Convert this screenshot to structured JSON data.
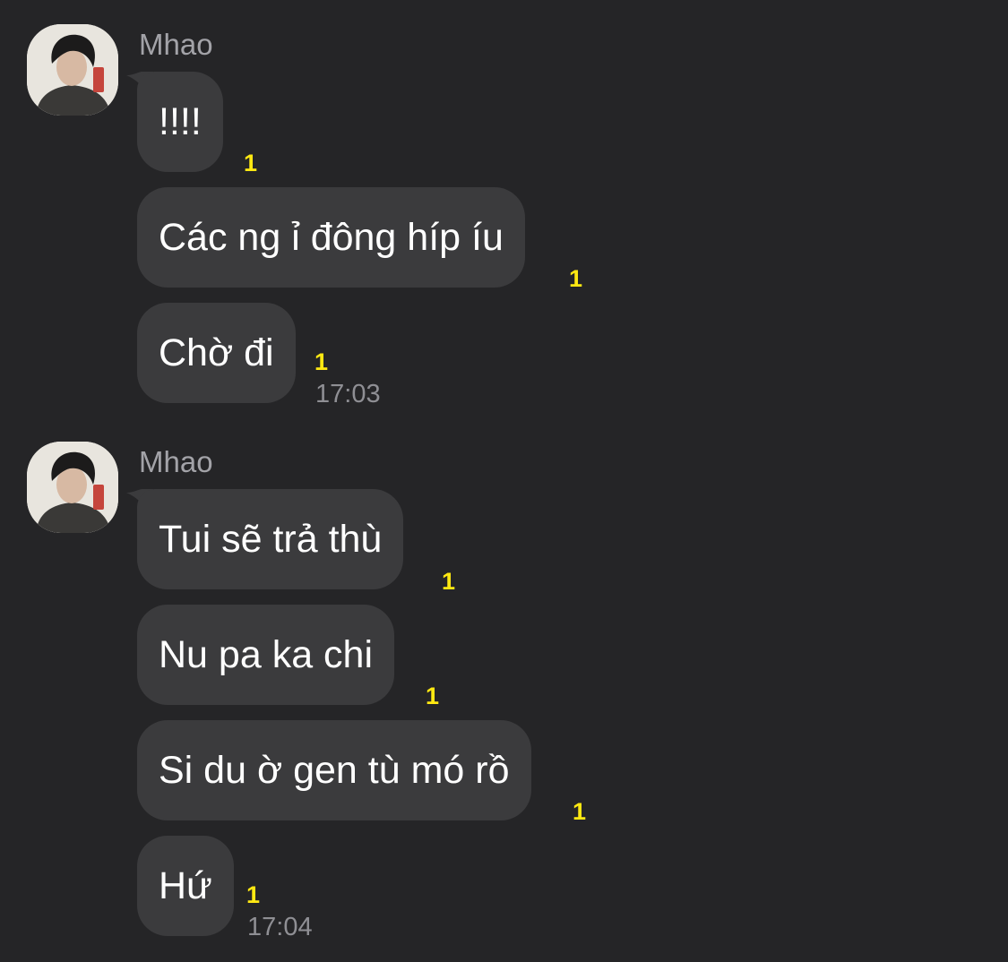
{
  "groups": [
    {
      "sender": "Mhao",
      "time": "17:03",
      "messages": [
        {
          "text": "!!!!",
          "unread": "1"
        },
        {
          "text": "Các ng ỉ đông híp íu",
          "unread": "1"
        },
        {
          "text": "Chờ đi",
          "unread": "1"
        }
      ]
    },
    {
      "sender": "Mhao",
      "time": "17:04",
      "messages": [
        {
          "text": "Tui sẽ trả thù",
          "unread": "1"
        },
        {
          "text": "Nu pa ka chi",
          "unread": "1"
        },
        {
          "text": "Si du ờ gen tù mó rồ",
          "unread": "1"
        },
        {
          "text": "Hứ",
          "unread": "1"
        }
      ]
    }
  ],
  "colors": {
    "background": "#252527",
    "bubble": "#3b3b3d",
    "unread_count": "#ffe812",
    "sender_name": "#a3a3a8",
    "timestamp": "#8f8f94"
  }
}
